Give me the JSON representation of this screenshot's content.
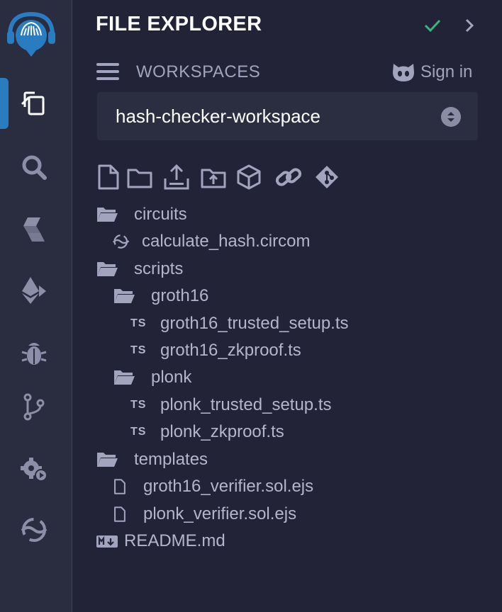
{
  "panel": {
    "title": "FILE EXPLORER",
    "workspaces_label": "WORKSPACES",
    "sign_in": "Sign in",
    "workspace_selected": "hash-checker-workspace"
  },
  "rail": {
    "items": [
      "file-explorer",
      "search",
      "solidity-compiler",
      "deploy-run",
      "debugger",
      "git",
      "settings",
      "circuit-compiler"
    ],
    "active": "file-explorer"
  },
  "toolbar": [
    "new-file",
    "new-folder",
    "publish-to-gist",
    "upload-file",
    "workspace-template",
    "link-github",
    "git-init"
  ],
  "tree": {
    "circuits": "circuits",
    "calculate_hash": "calculate_hash.circom",
    "scripts": "scripts",
    "groth16": "groth16",
    "groth16_setup": "groth16_trusted_setup.ts",
    "groth16_zk": "groth16_zkproof.ts",
    "plonk": "plonk",
    "plonk_setup": "plonk_trusted_setup.ts",
    "plonk_zk": "plonk_zkproof.ts",
    "templates": "templates",
    "groth16_verifier": "groth16_verifier.sol.ejs",
    "plonk_verifier": "plonk_verifier.sol.ejs",
    "readme": "README.md",
    "ts_badge": "TS"
  },
  "colors": {
    "accent": "#2a7cc0",
    "check": "#3fb37f",
    "background": "#222336",
    "rail": "#2a2c3f"
  }
}
